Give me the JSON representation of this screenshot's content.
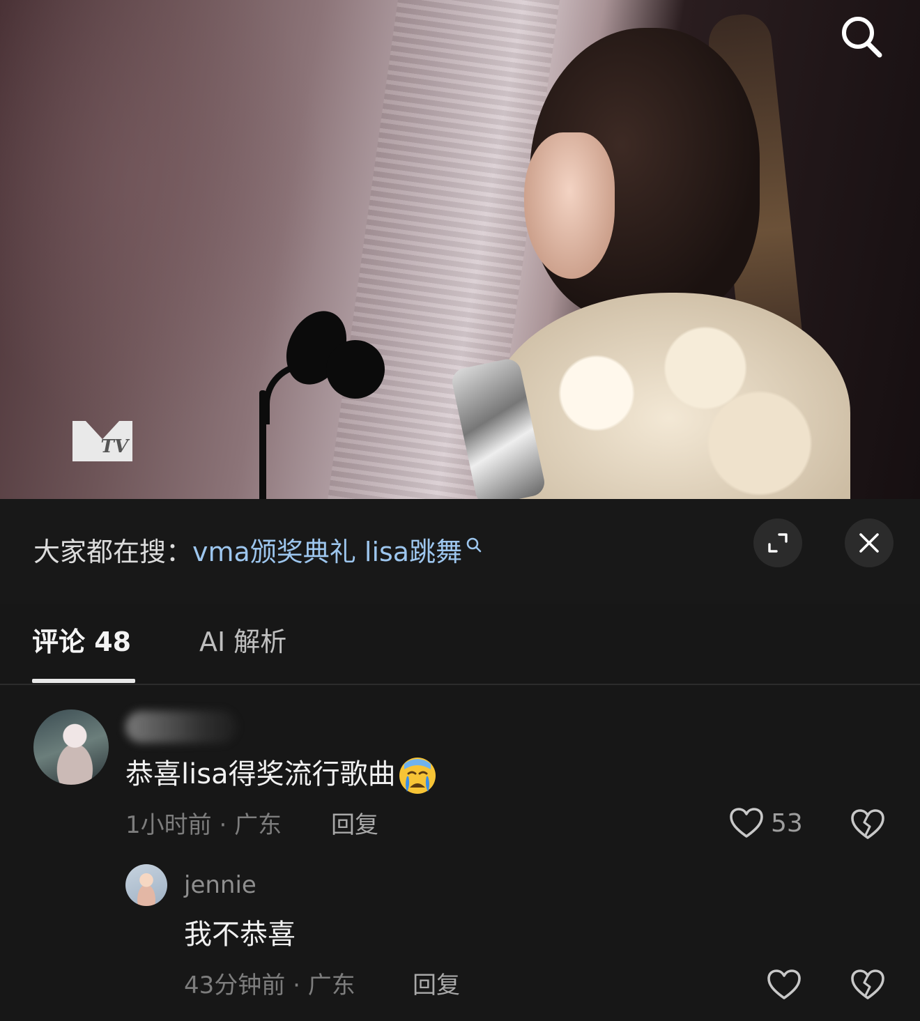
{
  "video": {
    "logo_text": "MTV",
    "search_icon": "search-icon"
  },
  "trending": {
    "prefix": "大家都在搜：",
    "query": "vma颁奖典礼 lisa跳舞",
    "icons": [
      "magnifier-icon",
      "expand-icon",
      "close-icon"
    ]
  },
  "tabs": [
    {
      "label": "评论 48",
      "active": true
    },
    {
      "label": "AI 解析",
      "active": false
    }
  ],
  "comments": [
    {
      "username_hidden": true,
      "text": "恭喜lisa得奖流行歌曲",
      "emoji": "crying-face",
      "time": "1小时前",
      "location": "广东",
      "reply_label": "回复",
      "likes": "53",
      "replies": [
        {
          "username": "jennie",
          "text": "我不恭喜",
          "time": "43分钟前",
          "location": "广东",
          "reply_label": "回复",
          "likes": ""
        }
      ]
    }
  ],
  "colors": {
    "background": "#171717",
    "link": "#9dc6ee",
    "muted": "#7d7d7d"
  }
}
